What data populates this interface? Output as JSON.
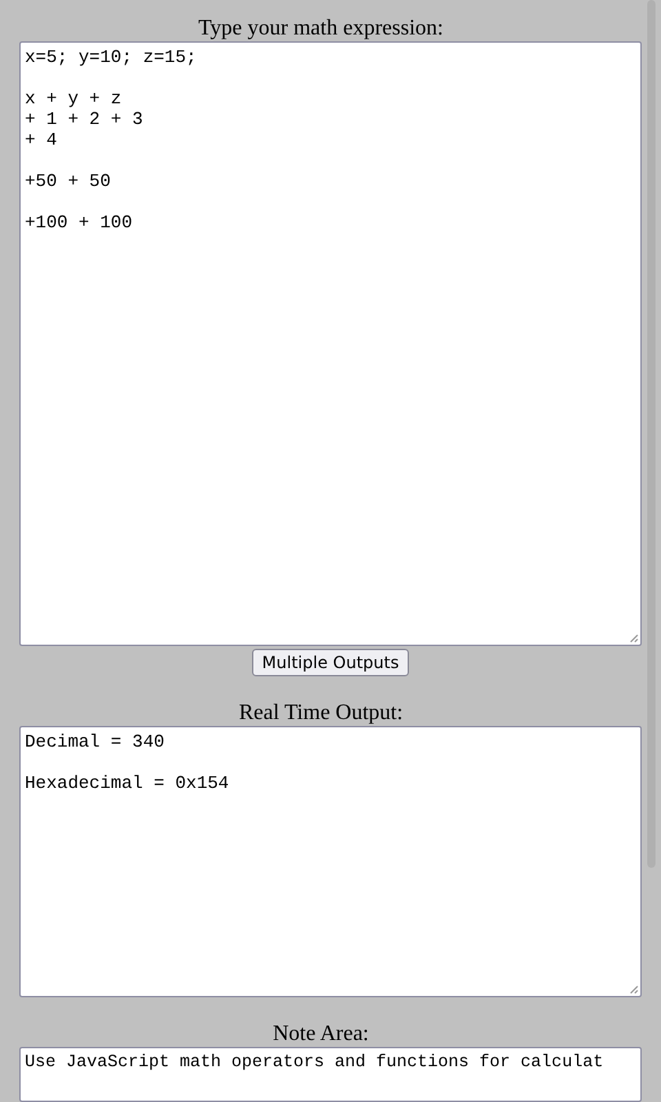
{
  "expression": {
    "label": "Type your math expression:",
    "value": "x=5; y=10; z=15;\n\nx + y + z\n+ 1 + 2 + 3\n+ 4\n\n+50 + 50\n\n+100 + 100"
  },
  "button": {
    "label": "Multiple Outputs"
  },
  "output": {
    "label": "Real Time Output:",
    "value": "Decimal = 340\n\nHexadecimal = 0x154"
  },
  "note": {
    "label": "Note Area:",
    "value": "Use JavaScript math operators and functions for calculat"
  }
}
